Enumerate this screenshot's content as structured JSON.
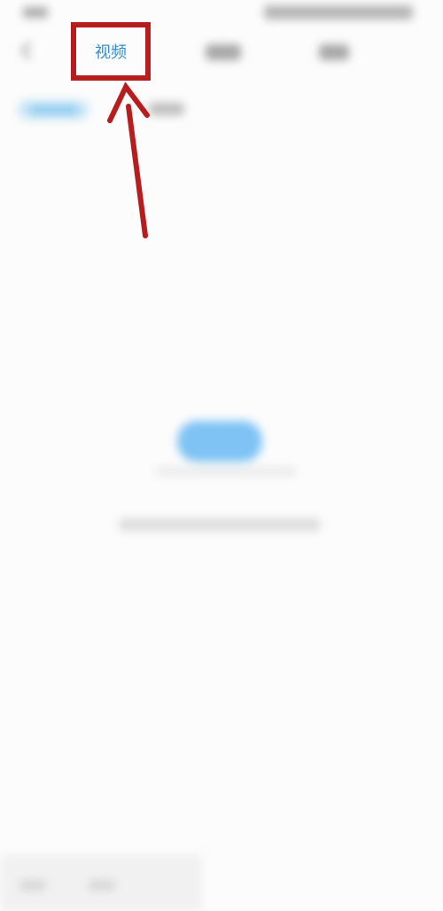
{
  "tabs": [
    {
      "label": "视频",
      "active": true
    }
  ],
  "colors": {
    "accent": "#2f8fd6",
    "annotation": "#b81d1d",
    "empty_illustration": "#7ec3f4"
  },
  "icons": {
    "back": "back-arrow-icon",
    "annotation_arrow": "annotation-arrow-icon"
  }
}
